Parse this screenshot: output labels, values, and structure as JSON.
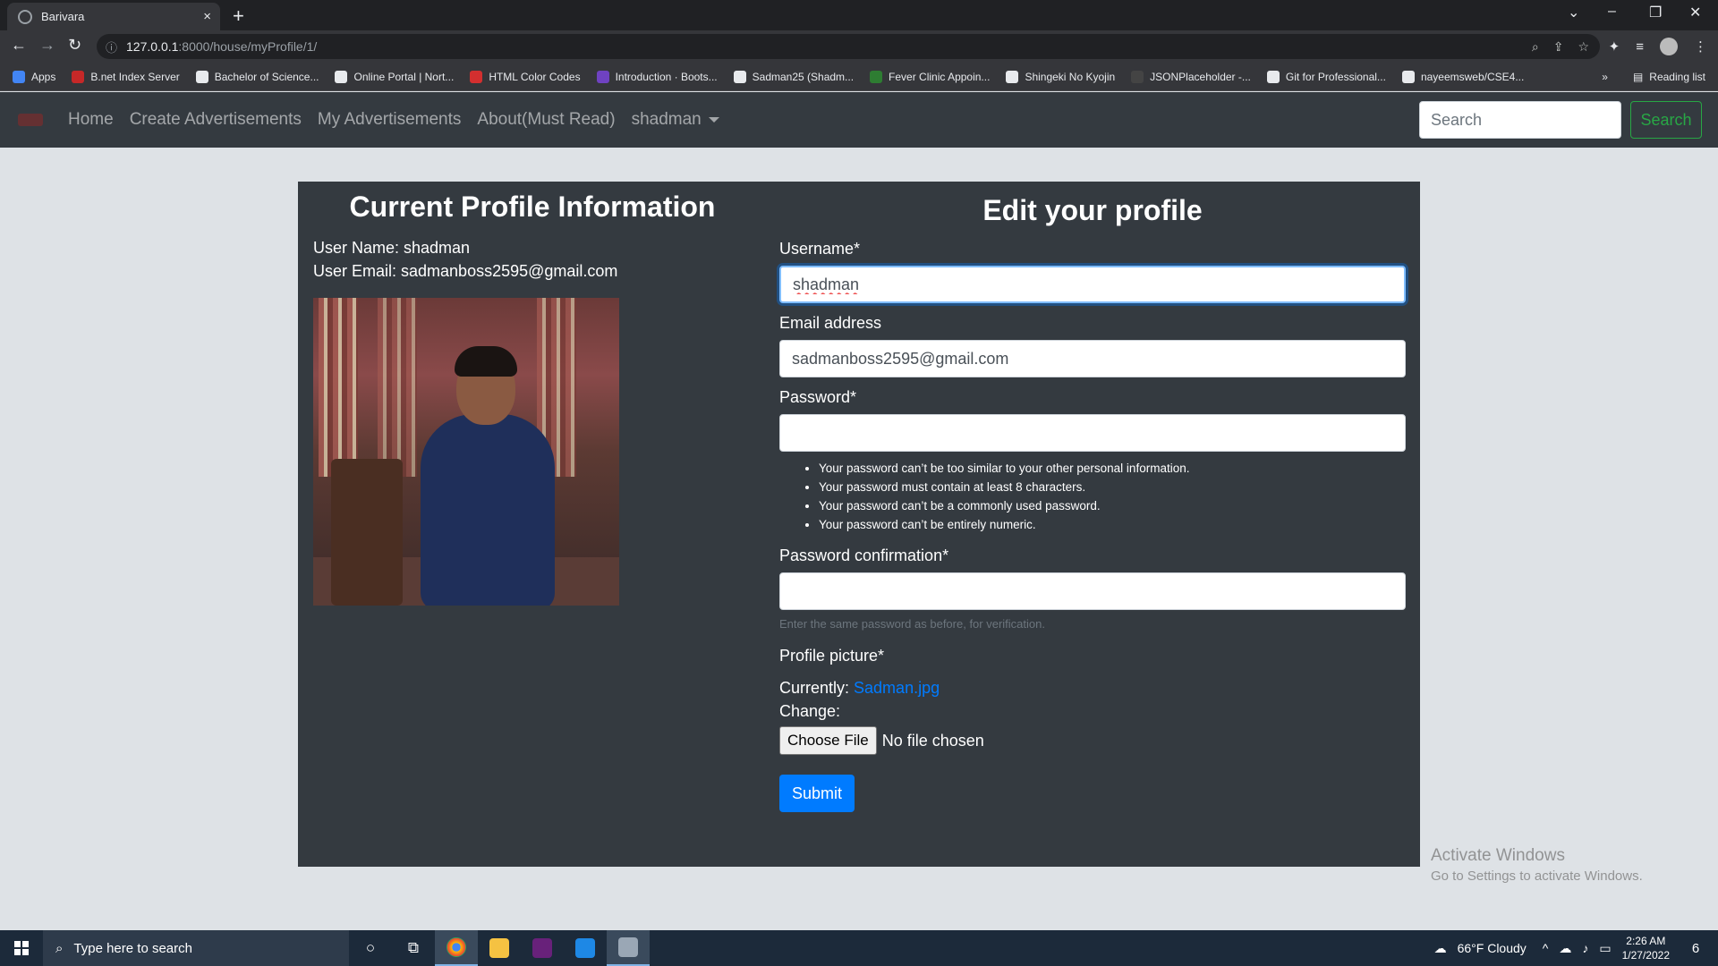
{
  "browser": {
    "tab_title": "Barivara",
    "tab_close": "×",
    "new_tab": "+",
    "url_host": "127.0.0.1",
    "url_path": ":8000/house/myProfile/1/",
    "reading_list": "Reading list",
    "bookmarks": [
      {
        "label": "Apps",
        "color": "#4285f4"
      },
      {
        "label": "B.net Index Server",
        "color": "#c62828"
      },
      {
        "label": "Bachelor of Science...",
        "color": "#e8eaed"
      },
      {
        "label": "Online Portal | Nort...",
        "color": "#e8eaed"
      },
      {
        "label": "HTML Color Codes",
        "color": "#d32f2f"
      },
      {
        "label": "Introduction · Boots...",
        "color": "#6f42c1"
      },
      {
        "label": "Sadman25 (Shadm...",
        "color": "#e8eaed"
      },
      {
        "label": "Fever Clinic Appoin...",
        "color": "#2e7d32"
      },
      {
        "label": "Shingeki No Kyojin",
        "color": "#e8eaed"
      },
      {
        "label": "JSONPlaceholder -...",
        "color": "#444"
      },
      {
        "label": "Git for Professional...",
        "color": "#e8eaed"
      },
      {
        "label": "nayeemsweb/CSE4...",
        "color": "#e8eaed"
      }
    ]
  },
  "navbar": {
    "links": [
      "Home",
      "Create Advertisements",
      "My Advertisements",
      "About(Must Read)"
    ],
    "user_menu": "shadman",
    "search_placeholder": "Search",
    "search_button": "Search"
  },
  "profile": {
    "title": "Current Profile Information",
    "username_line": "User Name: shadman",
    "email_line": "User Email: sadmanboss2595@gmail.com"
  },
  "form": {
    "title": "Edit your profile",
    "username_label": "Username*",
    "username_value": "shadman",
    "email_label": "Email address",
    "email_value": "sadmanboss2595@gmail.com",
    "password_label": "Password*",
    "password_hints": [
      "Your password can’t be too similar to your other personal information.",
      "Your password must contain at least 8 characters.",
      "Your password can’t be a commonly used password.",
      "Your password can’t be entirely numeric."
    ],
    "confirm_label": "Password confirmation*",
    "confirm_help": "Enter the same password as before, for verification.",
    "picture_label": "Profile picture*",
    "currently_label": "Currently: ",
    "currently_file": "Sadman.jpg",
    "change_label": "Change:",
    "choose_file": "Choose File",
    "no_file": "No file chosen",
    "submit": "Submit"
  },
  "watermark": {
    "line1": "Activate Windows",
    "line2": "Go to Settings to activate Windows."
  },
  "taskbar": {
    "search_placeholder": "Type here to search",
    "weather": "66°F  Cloudy",
    "time": "2:26 AM",
    "date": "1/27/2022",
    "notifications": "6"
  }
}
